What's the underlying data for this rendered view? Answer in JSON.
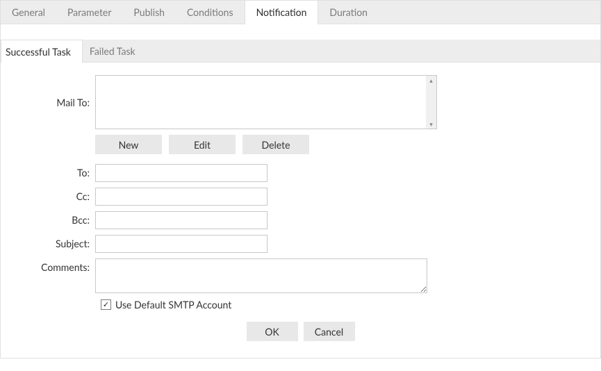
{
  "tabs": {
    "general": "General",
    "parameter": "Parameter",
    "publish": "Publish",
    "conditions": "Conditions",
    "notification": "Notification",
    "duration": "Duration"
  },
  "subtabs": {
    "success": "Successful Task",
    "failed": "Failed Task"
  },
  "labels": {
    "mail_to": "Mail To:",
    "to": "To:",
    "cc": "Cc:",
    "bcc": "Bcc:",
    "subject": "Subject:",
    "comments": "Comments:"
  },
  "buttons": {
    "new": "New",
    "edit": "Edit",
    "delete": "Delete",
    "ok": "OK",
    "cancel": "Cancel"
  },
  "fields": {
    "to": "",
    "cc": "",
    "bcc": "",
    "subject": "",
    "comments": ""
  },
  "smtp": {
    "label": "Use Default SMTP Account",
    "checked": true,
    "checkmark": "✓"
  },
  "scroll": {
    "up": "▴",
    "down": "▾"
  }
}
